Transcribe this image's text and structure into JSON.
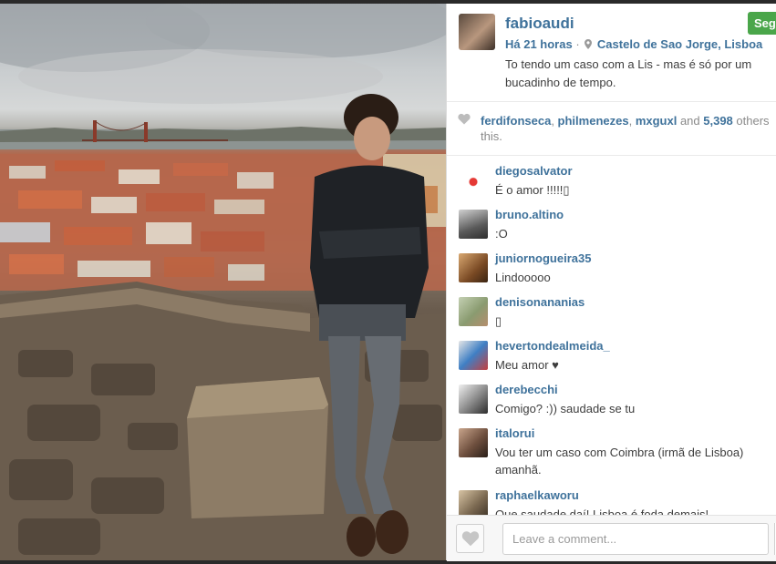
{
  "post": {
    "owner": "fabioaudi",
    "follow_label": "Seg",
    "time": "Há 21 horas",
    "separator": "·",
    "location": "Castelo de Sao Jorge, Lisboa",
    "caption": "To tendo um caso com a Lis - mas é só por um bucadinho de tempo."
  },
  "likes": {
    "users": [
      "ferdifonseca",
      "philmenezes",
      "mxguxl"
    ],
    "sep1": ", ",
    "sep2": ", ",
    "and_text": " and ",
    "count": "5,398",
    "suffix": " others like this.",
    "visible_suffix_a": " others",
    "visible_suffix_b": "this."
  },
  "comments": [
    {
      "user": "diegosalvator",
      "text": "É o amor !!!!!▯",
      "avatar_colors": [
        "#ffffff",
        "#e53935"
      ]
    },
    {
      "user": "bruno.altino",
      "text": ":O",
      "avatar_colors": [
        "#9b9b9b",
        "#444444"
      ]
    },
    {
      "user": "juniornogueira35",
      "text": "Lindooooo",
      "avatar_colors": [
        "#b8895c",
        "#5b3a1e"
      ]
    },
    {
      "user": "denisonananias",
      "text": "▯",
      "avatar_colors": [
        "#a7b59a",
        "#6a7d58"
      ]
    },
    {
      "user": "hevertondealmeida_",
      "text": "Meu amor ♥",
      "avatar_colors": [
        "#d9d9d9",
        "#1f6fb5"
      ]
    },
    {
      "user": "derebecchi",
      "text": "Comigo? :)) saudade se tu",
      "avatar_colors": [
        "#cfcfcf",
        "#3b3b3b"
      ]
    },
    {
      "user": "italorui",
      "text": "Vou ter um caso com Coimbra (irmã de Lisboa) amanhã.",
      "avatar_colors": [
        "#8a6a5a",
        "#2f2620"
      ]
    },
    {
      "user": "raphaelkaworu",
      "text": "Que saudade daí! Lisboa é foda demais!",
      "avatar_colors": [
        "#9c8b74",
        "#3a3024"
      ]
    }
  ],
  "footer": {
    "comment_placeholder": "Leave a comment..."
  },
  "icons": {
    "like_small": "heart-icon",
    "location": "map-pin-icon",
    "like_button": "heart-icon"
  },
  "colors": {
    "username": "#3f729b",
    "follow_button": "#4aa64a",
    "text": "#3d3d3d",
    "muted": "#8a8a8a"
  }
}
